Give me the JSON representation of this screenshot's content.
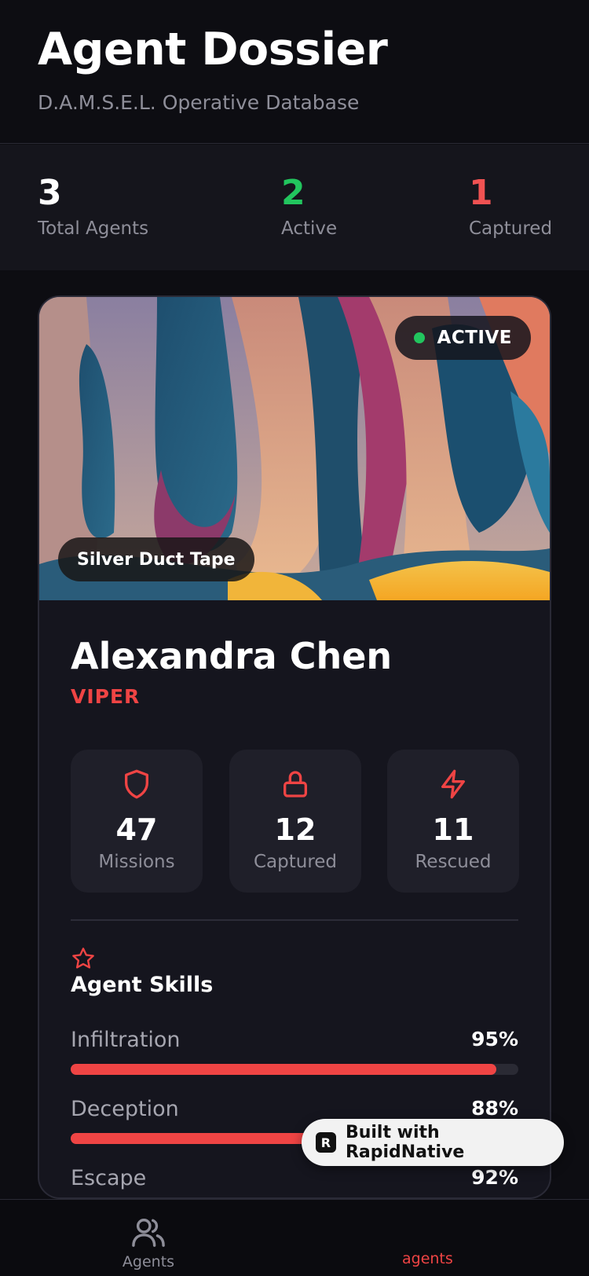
{
  "header": {
    "title": "Agent Dossier",
    "subtitle": "D.A.M.S.E.L. Operative Database"
  },
  "summary": {
    "total": {
      "value": "3",
      "label": "Total Agents"
    },
    "active": {
      "value": "2",
      "label": "Active",
      "color": "#22c55e"
    },
    "captured": {
      "value": "1",
      "label": "Captured",
      "color": "#f05252"
    }
  },
  "agent": {
    "status": "ACTIVE",
    "status_color": "#22c55e",
    "weapon": "Silver Duct Tape",
    "name": "Alexandra Chen",
    "codename": "VIPER",
    "metrics": [
      {
        "icon": "shield-icon",
        "value": "47",
        "label": "Missions"
      },
      {
        "icon": "lock-icon",
        "value": "12",
        "label": "Captured"
      },
      {
        "icon": "lightning-icon",
        "value": "11",
        "label": "Rescued"
      }
    ],
    "skills_title": "Agent Skills",
    "skills": [
      {
        "name": "Infiltration",
        "percent_label": "95%",
        "level": 0.95
      },
      {
        "name": "Deception",
        "percent_label": "88%",
        "level": 0.88
      },
      {
        "name": "Escape",
        "percent_label": "92%",
        "level": 0.92
      }
    ]
  },
  "tabs": {
    "agents": "Agents",
    "active": "agents"
  },
  "badge": {
    "text": "Built with RapidNative"
  },
  "accent": "#ef4444"
}
